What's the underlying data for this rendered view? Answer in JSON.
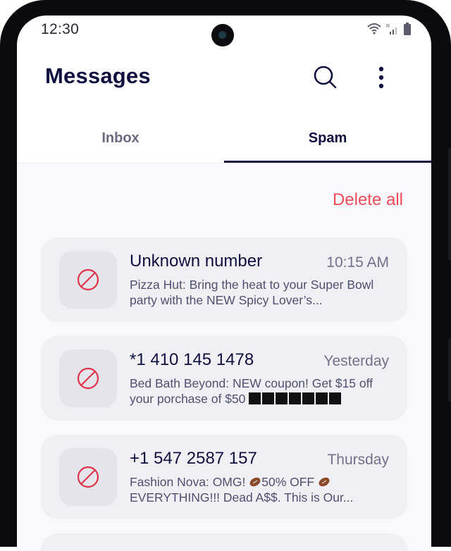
{
  "status_bar": {
    "time": "12:30",
    "icons": [
      "wifi-icon",
      "signal-icon",
      "battery-icon"
    ]
  },
  "header": {
    "title": "Messages",
    "search_icon": "search-icon",
    "more_icon": "more-vertical-icon"
  },
  "tabs": [
    {
      "label": "Inbox",
      "selected": false
    },
    {
      "label": "Spam",
      "selected": true
    }
  ],
  "actions": {
    "delete_all_label": "Delete all"
  },
  "messages": [
    {
      "sender": "Unknown number",
      "time": "10:15 AM",
      "preview": "Pizza Hut: Bring the heat to your Super Bowl party with the NEW Spicy Lover’s...",
      "icon": "blocked-icon"
    },
    {
      "sender": "*1 410 145 1478",
      "time": "Yesterday",
      "preview": "Bed Bath Beyond: NEW coupon! Get $15 off your porchase of $50",
      "redacted_blocks": 7,
      "icon": "blocked-icon"
    },
    {
      "sender": "+1 547 2587 157",
      "time": "Thursday",
      "preview_parts": [
        "Fashion Nova: OMG! ",
        "50% OFF ",
        " EVERYTHING!!! Dead A$$. This is Our..."
      ],
      "icon": "blocked-icon"
    }
  ],
  "colors": {
    "title": "#101040",
    "accent_danger": "#ef4b5a",
    "card_bg": "#f0f0f4",
    "blocked_icon": "#e0334a"
  }
}
